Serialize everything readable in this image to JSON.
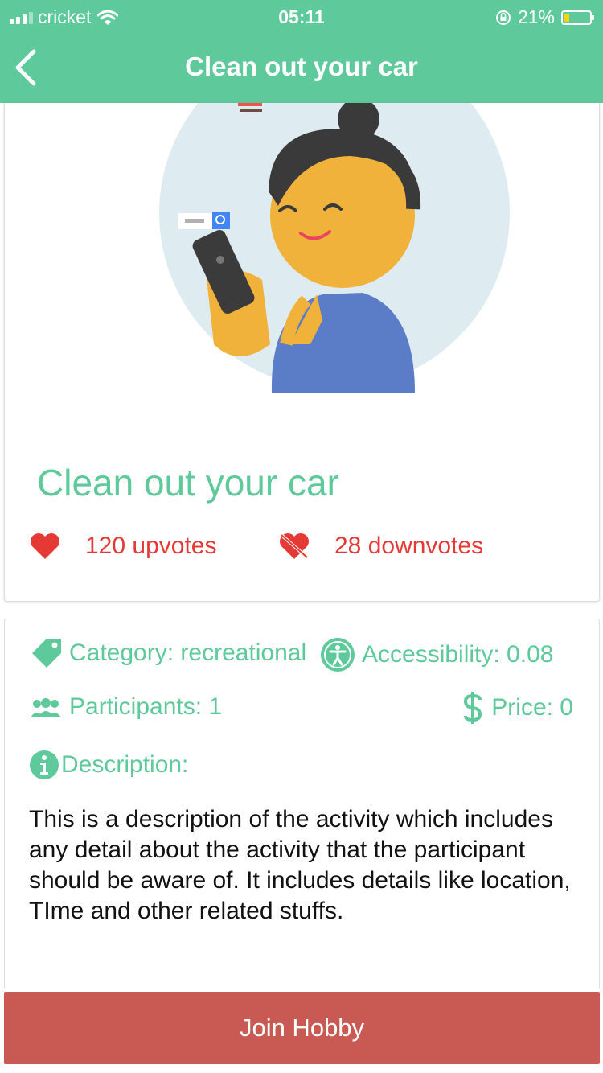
{
  "status_bar": {
    "carrier": "cricket",
    "time": "05:11",
    "battery": "21%",
    "battery_level": 0.21
  },
  "nav": {
    "title": "Clean out your car",
    "back_icon": "chevron-left-icon"
  },
  "activity": {
    "title": "Clean out your car",
    "upvotes": "120 upvotes",
    "downvotes": "28 downvotes"
  },
  "details": {
    "category": "Category: recreational",
    "accessibility": "Accessibility: 0.08",
    "participants": "Participants: 1",
    "price": "Price: 0",
    "description_label": "Description:",
    "description": "This is a description of the activity which includes any detail about the activity that the participant should be aware of. It includes details like location, TIme and other related stuffs."
  },
  "join_button": {
    "label": "Join Hobby"
  },
  "colors": {
    "accent": "#5ec99a",
    "vote": "#e53935",
    "button": "#c95953"
  }
}
